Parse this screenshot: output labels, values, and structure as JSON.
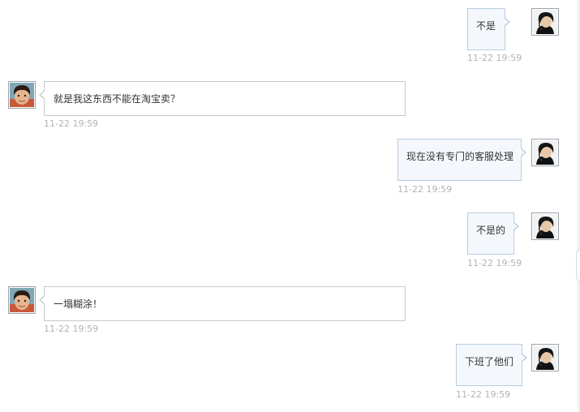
{
  "messages": [
    {
      "side": "right",
      "text": "不是",
      "time": "11-22 19:59",
      "avatar": "agent-avatar-icon"
    },
    {
      "side": "left",
      "text": "就是我这东西不能在淘宝卖？",
      "time": "11-22 19:59",
      "avatar": "customer-avatar-icon"
    },
    {
      "side": "right",
      "text": "现在没有专门的客服处理",
      "time": "11-22 19:59",
      "avatar": "agent-avatar-icon"
    },
    {
      "side": "right",
      "text": "不是的",
      "time": "11-22 19:59",
      "avatar": "agent-avatar-icon"
    },
    {
      "side": "left",
      "text": "一塌糊涂！",
      "time": "11-22 19:59",
      "avatar": "customer-avatar-icon"
    },
    {
      "side": "right",
      "text": "下班了他们",
      "time": "11-22 19:59",
      "avatar": "agent-avatar-icon"
    }
  ],
  "colors": {
    "right_bubble_bg": "#f4f8fd",
    "right_bubble_border": "#b8cde0",
    "left_bubble_bg": "#ffffff",
    "left_bubble_border": "#c8c8c8",
    "timestamp": "#b0b4b8"
  }
}
